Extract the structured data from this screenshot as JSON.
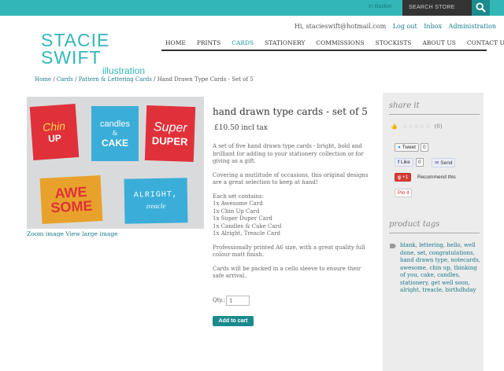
{
  "topbar": {
    "basket": "In Basket",
    "search_placeholder": "SEARCH STORE"
  },
  "user": {
    "greeting": "Hi, stacieswift@hotmail.com",
    "logout": "Log out",
    "inbox": "Inbox",
    "admin": "Administration"
  },
  "logo": {
    "main": "STACIE SWIFT",
    "sub": "illustration"
  },
  "nav": [
    "HOME",
    "PRINTS",
    "CARDS",
    "STATIONERY",
    "COMMISSIONS",
    "STOCKISTS",
    "ABOUT US",
    "CONTACT US"
  ],
  "breadcrumb": {
    "home": "Home",
    "cards": "Cards",
    "pattern": "Pattern & Lettering Cards",
    "current": "Hand Drawn Type Cards - Set of 5",
    "sep": " / "
  },
  "product": {
    "title": "hand drawn type cards - set of 5",
    "price": "£10.50 incl tax",
    "desc1": "A set of five hand drawn type cards - bright, bold and brilliant for adding to your stationery collection or for giving as a gift.",
    "desc2": "Covering a mutlitude of occasions, this original designs are a great selection to keep at hand!",
    "contains_label": "Each set contains:",
    "contents": [
      "1x Awesome Card",
      "1x Chin Up Card",
      "1x Super Duper Card",
      "1x Candles & Cake Card",
      "1x Alright, Treacle Card"
    ],
    "desc3": "Professionally printed A6 size, with a great quality full colour matt finish.",
    "desc4": "Cards will be packed in a cello sleeve to ensure their safe arrival.",
    "qty_label": "Qty.:",
    "qty_value": "1",
    "add_to_cart": "Add to cart",
    "zoom": "Zoom image",
    "view_large": "View large image"
  },
  "cards_art": {
    "chin": "Chin",
    "up": "UP",
    "candles": "candles",
    "amp": "&",
    "cake": "CAKE",
    "super": "Super",
    "duper": "DUPER",
    "awe": "AWE",
    "some": "SOME",
    "alright": "ALRIGHT,",
    "treacle": "treacle"
  },
  "sidebar": {
    "share_title": "share it",
    "rating_count": "(0)",
    "tweet": "Tweet",
    "tweet_count": "0",
    "like": "Like",
    "like_count": "0",
    "send": "Send",
    "gplus": "+1",
    "gplus_text": "Recommend this",
    "pin": "Pin it",
    "tags_title": "product tags",
    "tags": [
      "blank",
      "lettering",
      "hello",
      "well done",
      "set",
      "congratulations",
      "hand drawn type",
      "notecards",
      "awesome",
      "chin up",
      "thinking of you",
      "cake",
      "candles",
      "stationery",
      "get well soon",
      "alright",
      "treacle",
      "birthdhday"
    ]
  },
  "colors": {
    "teal": "#33b6b8",
    "dark": "#333333",
    "link": "#1a7a8a",
    "card_red": "#e0313a",
    "card_blue": "#3aaed8",
    "card_yellow": "#e8a22b"
  }
}
